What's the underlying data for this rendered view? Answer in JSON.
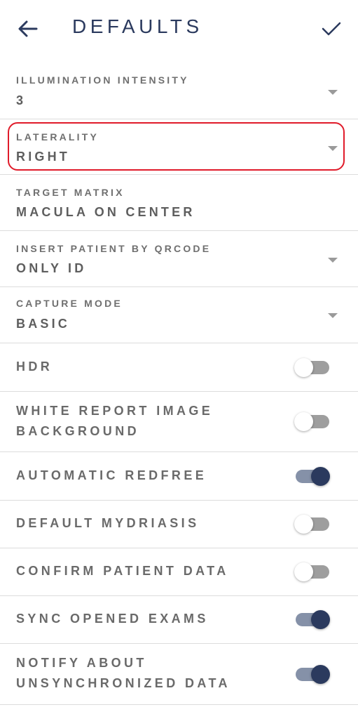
{
  "header": {
    "title": "DEFAULTS",
    "back_icon": "arrow-left-icon",
    "confirm_icon": "check-icon"
  },
  "dropdowns": [
    {
      "label": "ILLUMINATION INTENSITY",
      "value": "3"
    },
    {
      "label": "LATERALITY",
      "value": "RIGHT"
    },
    {
      "label": "TARGET MATRIX",
      "value": "MACULA ON CENTER"
    },
    {
      "label": "INSERT PATIENT BY QRCODE",
      "value": "ONLY ID"
    },
    {
      "label": "CAPTURE MODE",
      "value": "BASIC"
    }
  ],
  "toggles": [
    {
      "label": "HDR",
      "on": false
    },
    {
      "label_line1": "WHITE REPORT IMAGE",
      "label_line2": "BACKGROUND",
      "on": false
    },
    {
      "label": "AUTOMATIC REDFREE",
      "on": true
    },
    {
      "label": "DEFAULT MYDRIASIS",
      "on": false
    },
    {
      "label": "CONFIRM PATIENT DATA",
      "on": false
    },
    {
      "label": "SYNC OPENED EXAMS",
      "on": true
    },
    {
      "label_line1": "NOTIFY ABOUT",
      "label_line2": "UNSYNCHRONIZED DATA",
      "on": true
    }
  ],
  "colors": {
    "accent": "#2b3a5e",
    "highlight": "#e01b2a"
  }
}
